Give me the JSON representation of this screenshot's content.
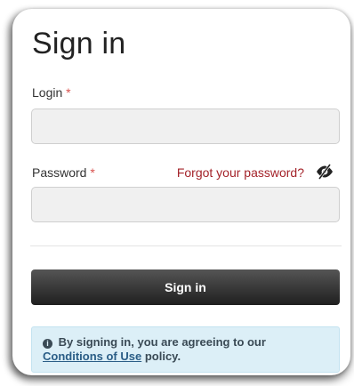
{
  "form": {
    "title": "Sign in",
    "login_label": "Login",
    "password_label": "Password",
    "required_marker": "*",
    "login_value": "",
    "login_placeholder": "",
    "password_value": "",
    "password_placeholder": "",
    "forgot_link": "Forgot your password?",
    "toggle_icon": "eye-slash-icon",
    "submit_label": "Sign in"
  },
  "notice": {
    "icon": "info-circle-icon",
    "text_before": "By signing in, you are agreeing to our",
    "link_text": "Conditions of Use",
    "text_after": "policy."
  },
  "colors": {
    "required": "#d9534f",
    "forgot_link": "#a4232a",
    "button_dark": "#1f1f1f",
    "notice_bg": "#dceff7"
  }
}
